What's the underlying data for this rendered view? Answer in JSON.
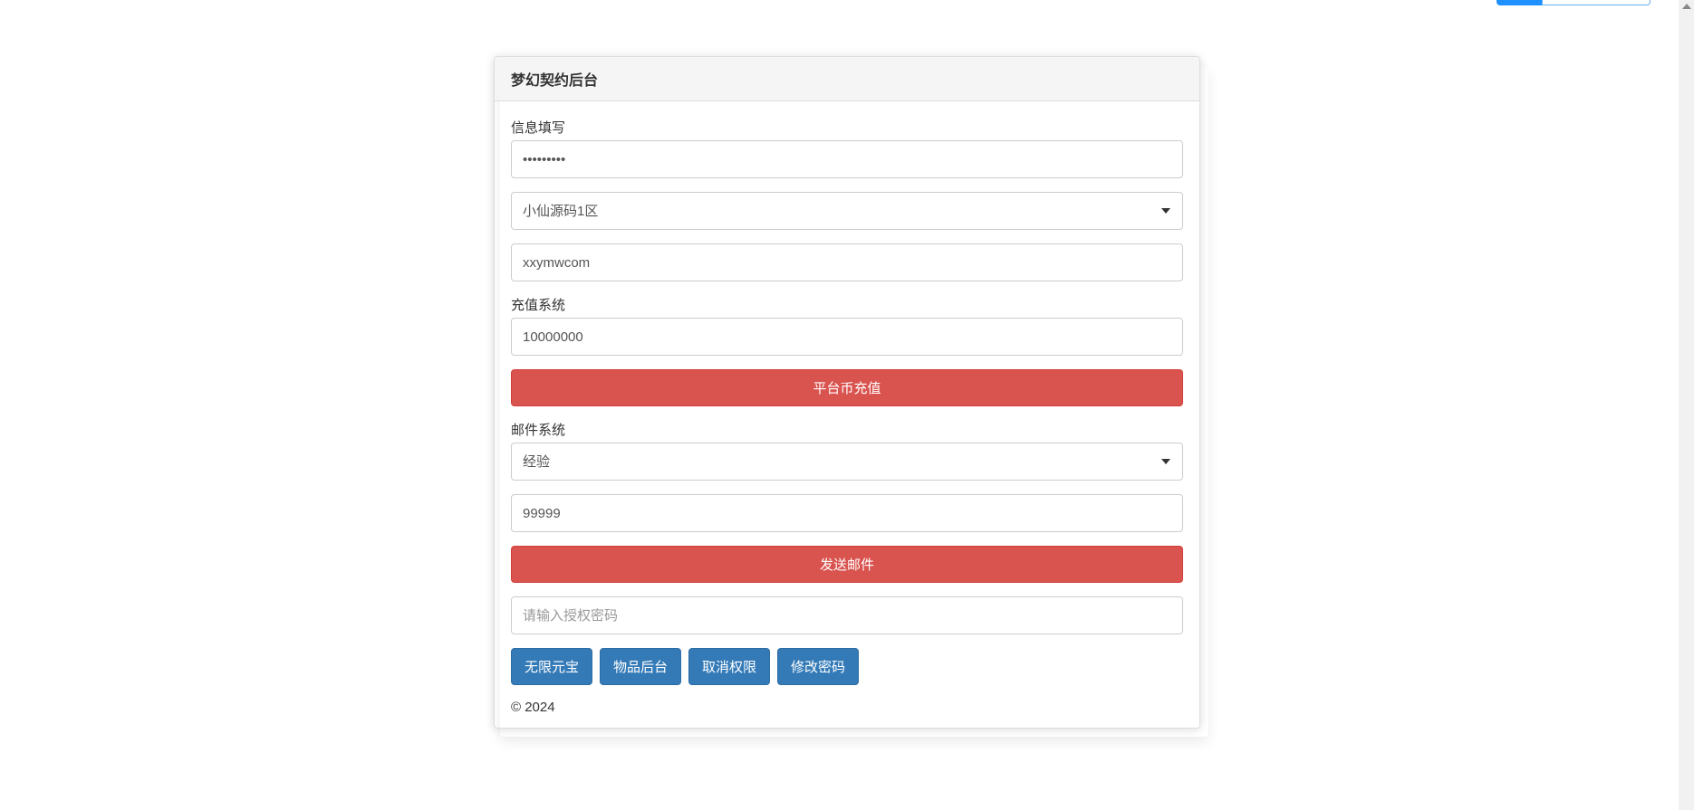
{
  "panel": {
    "title": "梦幻契约后台"
  },
  "info": {
    "label": "信息填写",
    "password_value": "•••••••••",
    "server_selected": "小仙源码1区",
    "username_value": "xxymwcom"
  },
  "recharge": {
    "label": "充值系统",
    "amount_value": "10000000",
    "button_label": "平台币充值"
  },
  "mail": {
    "label": "邮件系统",
    "type_selected": "经验",
    "amount_value": "99999",
    "button_label": "发送邮件"
  },
  "auth": {
    "placeholder": "请输入授权密码"
  },
  "actions": {
    "unlimited_gold": "无限元宝",
    "item_backend": "物品后台",
    "cancel_auth": "取消权限",
    "change_password": "修改密码"
  },
  "footer": {
    "copyright": "© 2024"
  }
}
